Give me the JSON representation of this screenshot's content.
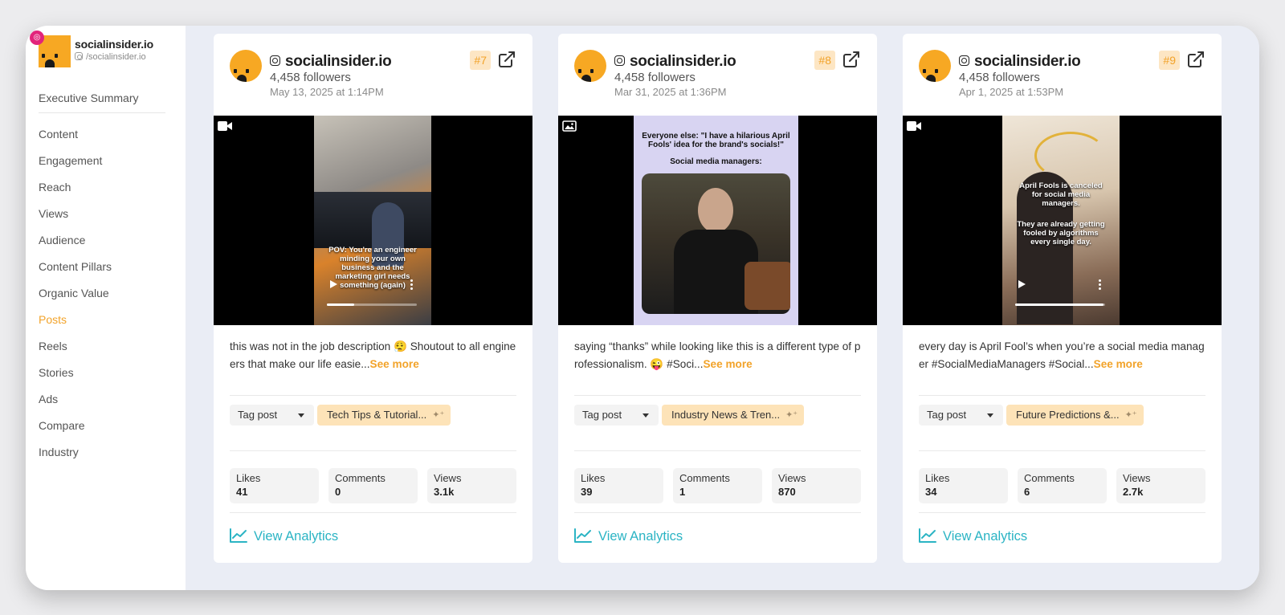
{
  "sidebar": {
    "brand_name": "socialinsider.io",
    "brand_handle": "/socialinsider.io",
    "nav": [
      "Executive Summary",
      "Content",
      "Engagement",
      "Reach",
      "Views",
      "Audience",
      "Content Pillars",
      "Organic Value",
      "Posts",
      "Reels",
      "Stories",
      "Ads",
      "Compare",
      "Industry"
    ],
    "active_item": "Posts"
  },
  "colors": {
    "accent": "#f2a32a",
    "brand_orange": "#f7a823",
    "analytics_link": "#2bb4c4",
    "pillar_bg": "#fde3b8",
    "instagram_badge": "#e2247b"
  },
  "posts": [
    {
      "account": "socialinsider.io",
      "followers": "4,458 followers",
      "date": "May 13, 2025 at 1:14PM",
      "rank": "#7",
      "media_type": "video",
      "media_overlay": "POV: You're an engineer minding your own business and the marketing girl needs something (again)",
      "caption": "this was not in the job description 😮‍💨 Shoutout to all engineers that make our life easie...",
      "see_more": "See more",
      "tag_label": "Tag post",
      "pillar": "Tech Tips & Tutorial...",
      "stats": [
        {
          "label": "Likes",
          "value": "41"
        },
        {
          "label": "Comments",
          "value": "0"
        },
        {
          "label": "Views",
          "value": "3.1k"
        }
      ],
      "analytics_label": "View Analytics"
    },
    {
      "account": "socialinsider.io",
      "followers": "4,458 followers",
      "date": "Mar 31, 2025 at 1:36PM",
      "rank": "#8",
      "media_type": "image",
      "media_overlay": "Everyone else: \"I have a hilarious April Fools' idea for the brand's socials!\"",
      "media_overlay_2": "Social media managers:",
      "caption": "saying “thanks” while looking like this is a different type of professionalism. 😜 #Soci...",
      "see_more": "See more",
      "tag_label": "Tag post",
      "pillar": "Industry News & Tren...",
      "stats": [
        {
          "label": "Likes",
          "value": "39"
        },
        {
          "label": "Comments",
          "value": "1"
        },
        {
          "label": "Views",
          "value": "870"
        }
      ],
      "analytics_label": "View Analytics"
    },
    {
      "account": "socialinsider.io",
      "followers": "4,458 followers",
      "date": "Apr 1, 2025 at 1:53PM",
      "rank": "#9",
      "media_type": "video",
      "media_overlay": "April Fools is canceled for social media managers.",
      "media_overlay_2": "They are already getting fooled by algorithms every single day.",
      "caption": "every day is April Fool’s when you’re a social media manager #SocialMediaManagers #Social...",
      "see_more": "See more",
      "tag_label": "Tag post",
      "pillar": "Future Predictions &...",
      "stats": [
        {
          "label": "Likes",
          "value": "34"
        },
        {
          "label": "Comments",
          "value": "6"
        },
        {
          "label": "Views",
          "value": "2.7k"
        }
      ],
      "analytics_label": "View Analytics"
    }
  ]
}
